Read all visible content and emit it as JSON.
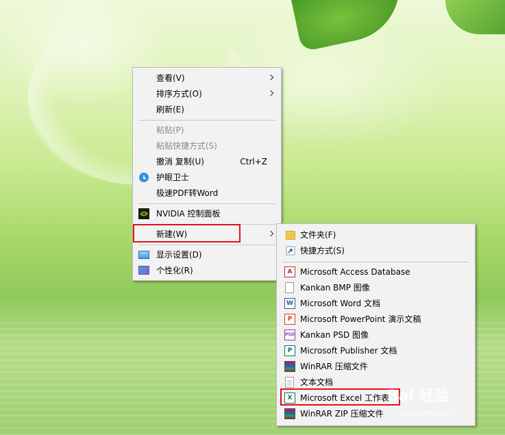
{
  "context_menu": {
    "items": [
      {
        "label": "查看(V)",
        "submenu": true
      },
      {
        "label": "排序方式(O)",
        "submenu": true
      },
      {
        "label": "刷新(E)"
      },
      {
        "label": "粘贴(P)",
        "disabled": true
      },
      {
        "label": "粘贴快捷方式(S)",
        "disabled": true
      },
      {
        "label": "撤消 复制(U)",
        "shortcut": "Ctrl+Z"
      },
      {
        "label": "护眼卫士",
        "icon": "eye-guard-icon"
      },
      {
        "label": "极速PDF转Word"
      },
      {
        "label": "NVIDIA 控制面板",
        "icon": "nvidia-icon"
      },
      {
        "label": "新建(W)",
        "submenu": true,
        "highlighted": true
      },
      {
        "label": "显示设置(D)",
        "icon": "display-icon"
      },
      {
        "label": "个性化(R)",
        "icon": "personalize-icon"
      }
    ]
  },
  "new_submenu": {
    "items": [
      {
        "label": "文件夹(F)",
        "icon": "folder-icon"
      },
      {
        "label": "快捷方式(S)",
        "icon": "shortcut-icon"
      },
      {
        "label": "Microsoft Access Database",
        "icon": "access-icon"
      },
      {
        "label": "Kankan BMP 图像",
        "icon": "bmp-icon"
      },
      {
        "label": "Microsoft Word 文档",
        "icon": "word-icon"
      },
      {
        "label": "Microsoft PowerPoint 演示文稿",
        "icon": "powerpoint-icon"
      },
      {
        "label": "Kankan PSD 图像",
        "icon": "psd-icon"
      },
      {
        "label": "Microsoft Publisher 文档",
        "icon": "publisher-icon"
      },
      {
        "label": "WinRAR 压缩文件",
        "icon": "winrar-icon"
      },
      {
        "label": "文本文档",
        "icon": "text-doc-icon"
      },
      {
        "label": "Microsoft Excel 工作表",
        "icon": "excel-icon",
        "highlighted": true
      },
      {
        "label": "WinRAR ZIP 压缩文件",
        "icon": "winrar-zip-icon"
      }
    ]
  },
  "watermark": {
    "brand": "Bai 经验",
    "url": "jingyan.baidu.com"
  },
  "colors": {
    "highlight_box": "#e0101a",
    "menu_bg": "#f2f2f2"
  }
}
